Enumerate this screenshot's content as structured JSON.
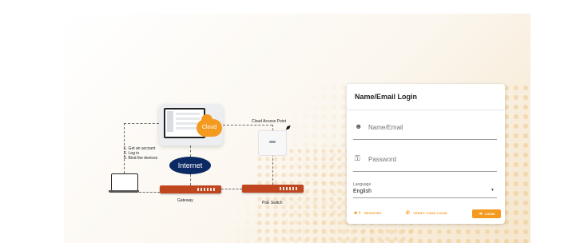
{
  "diagram": {
    "cloud_label": "Cloud",
    "internet_label": "Internet",
    "steps": [
      "1. Get an account",
      "2. Log in",
      "3. Bind the devices"
    ],
    "gateway_label": "Gateway",
    "poe_switch_label": "PoE Switch",
    "access_point_label": "Cloud Access Point"
  },
  "login": {
    "title": "Name/Email Login",
    "username_placeholder": "Name/Email",
    "password_placeholder": "Password",
    "language_label": "Language",
    "language_value": "English",
    "register_label": "REGISTER",
    "verify_code_label": "VERIFY CODE LOGIN",
    "login_label": "LOGIN"
  },
  "icons": {
    "user": "account-circle-icon",
    "password": "key-icon",
    "dropdown": "caret-down-icon",
    "register": "person-add-icon",
    "verify": "phone-icon",
    "login": "login-icon",
    "wifi": "wifi-icon"
  },
  "colors": {
    "accent": "#f39a1f",
    "internet": "#0b2a63",
    "device": "#c0461f"
  }
}
